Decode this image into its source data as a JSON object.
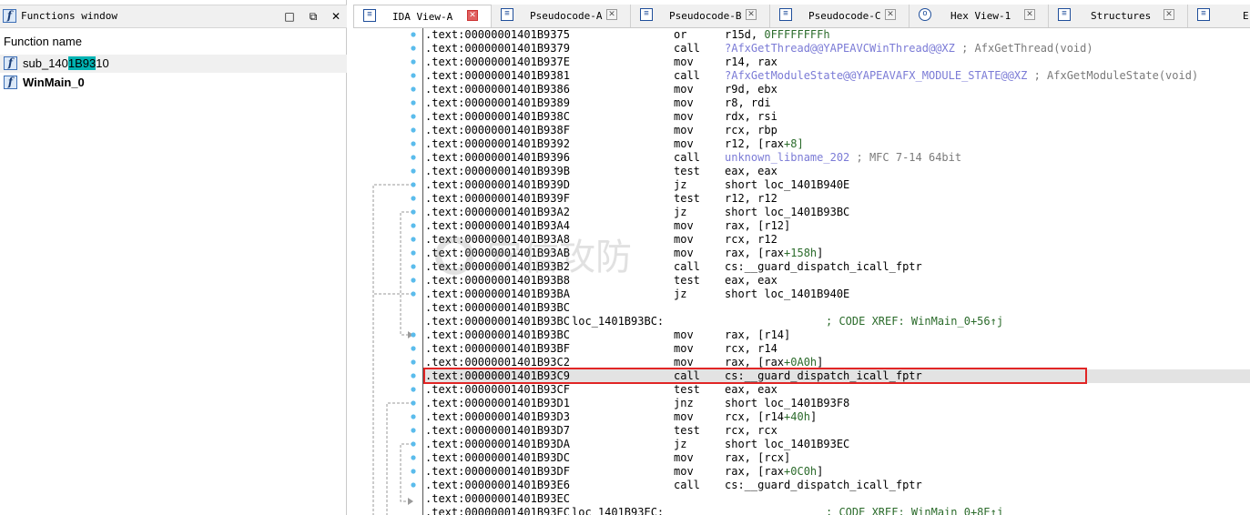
{
  "functions_window": {
    "title": "Functions window",
    "column_header": "Function name",
    "items": [
      {
        "name_pre": "sub_140",
        "name_hl": "1B93",
        "name_post": "10",
        "selected": true
      },
      {
        "name": "WinMain_0",
        "bold": true
      }
    ],
    "buttons": {
      "restore": "□",
      "float": "⧉",
      "close": "✕"
    }
  },
  "tabs": [
    {
      "label": "IDA View-A",
      "active": true
    },
    {
      "label": "Pseudocode-A"
    },
    {
      "label": "Pseudocode-B"
    },
    {
      "label": "Pseudocode-C"
    },
    {
      "label": "Hex View-1"
    },
    {
      "label": "Structures"
    },
    {
      "label": "E"
    }
  ],
  "disassembly": [
    {
      "addr": ".text:00000001401B9375",
      "mn": "or",
      "op": "r15d, 0FFFFFFFFh"
    },
    {
      "addr": ".text:00000001401B9379",
      "mn": "call",
      "op": "?AfxGetThread@@YAPEAVCWinThread@@XZ",
      "cm": " ; AfxGetThread(void)"
    },
    {
      "addr": ".text:00000001401B937E",
      "mn": "mov",
      "op": "r14, rax"
    },
    {
      "addr": ".text:00000001401B9381",
      "mn": "call",
      "op": "?AfxGetModuleState@@YAPEAVAFX_MODULE_STATE@@XZ",
      "cm": " ; AfxGetModuleState(void)"
    },
    {
      "addr": ".text:00000001401B9386",
      "mn": "mov",
      "op": "r9d, ebx"
    },
    {
      "addr": ".text:00000001401B9389",
      "mn": "mov",
      "op": "r8, rdi"
    },
    {
      "addr": ".text:00000001401B938C",
      "mn": "mov",
      "op": "rdx, rsi"
    },
    {
      "addr": ".text:00000001401B938F",
      "mn": "mov",
      "op": "rcx, rbp"
    },
    {
      "addr": ".text:00000001401B9392",
      "mn": "mov",
      "op": "r12, [rax+8]"
    },
    {
      "addr": ".text:00000001401B9396",
      "mn": "call",
      "op": "unknown_libname_202",
      "cm": " ; MFC 7-14 64bit"
    },
    {
      "addr": ".text:00000001401B939B",
      "mn": "test",
      "op": "eax, eax"
    },
    {
      "addr": ".text:00000001401B939D",
      "mn": "jz",
      "op": "short loc_1401B940E"
    },
    {
      "addr": ".text:00000001401B939F",
      "mn": "test",
      "op": "r12, r12"
    },
    {
      "addr": ".text:00000001401B93A2",
      "mn": "jz",
      "op": "short loc_1401B93BC"
    },
    {
      "addr": ".text:00000001401B93A4",
      "mn": "mov",
      "op": "rax, [r12]"
    },
    {
      "addr": ".text:00000001401B93A8",
      "mn": "mov",
      "op": "rcx, r12"
    },
    {
      "addr": ".text:00000001401B93AB",
      "mn": "mov",
      "op": "rax, [rax+158h]"
    },
    {
      "addr": ".text:00000001401B93B2",
      "mn": "call",
      "op": "cs:__guard_dispatch_icall_fptr"
    },
    {
      "addr": ".text:00000001401B93B8",
      "mn": "test",
      "op": "eax, eax"
    },
    {
      "addr": ".text:00000001401B93BA",
      "mn": "jz",
      "op": "short loc_1401B940E"
    },
    {
      "addr": ".text:00000001401B93BC"
    },
    {
      "addr": ".text:00000001401B93BC",
      "lbl": "loc_1401B93BC:",
      "xref": "; CODE XREF: WinMain_0+56↑j"
    },
    {
      "addr": ".text:00000001401B93BC",
      "mn": "mov",
      "op": "rax, [r14]"
    },
    {
      "addr": ".text:00000001401B93BF",
      "mn": "mov",
      "op": "rcx, r14"
    },
    {
      "addr": ".text:00000001401B93C2",
      "mn": "mov",
      "op": "rax, [rax+0A0h]"
    },
    {
      "addr": ".text:00000001401B93C9",
      "mn": "call",
      "op": "cs:__guard_dispatch_icall_fptr",
      "current": true
    },
    {
      "addr": ".text:00000001401B93CF",
      "mn": "test",
      "op": "eax, eax"
    },
    {
      "addr": ".text:00000001401B93D1",
      "mn": "jnz",
      "op": "short loc_1401B93F8"
    },
    {
      "addr": ".text:00000001401B93D3",
      "mn": "mov",
      "op": "rcx, [r14+40h]"
    },
    {
      "addr": ".text:00000001401B93D7",
      "mn": "test",
      "op": "rcx, rcx"
    },
    {
      "addr": ".text:00000001401B93DA",
      "mn": "jz",
      "op": "short loc_1401B93EC"
    },
    {
      "addr": ".text:00000001401B93DC",
      "mn": "mov",
      "op": "rax, [rcx]"
    },
    {
      "addr": ".text:00000001401B93DF",
      "mn": "mov",
      "op": "rax, [rax+0C0h]"
    },
    {
      "addr": ".text:00000001401B93E6",
      "mn": "call",
      "op": "cs:__guard_dispatch_icall_fptr"
    },
    {
      "addr": ".text:00000001401B93EC"
    },
    {
      "addr": ".text:00000001401B93EC",
      "lbl": "loc_1401B93EC:",
      "xref": "; CODE XREF: WinMain_0+8E↑j"
    }
  ],
  "watermark": "安信攻防"
}
